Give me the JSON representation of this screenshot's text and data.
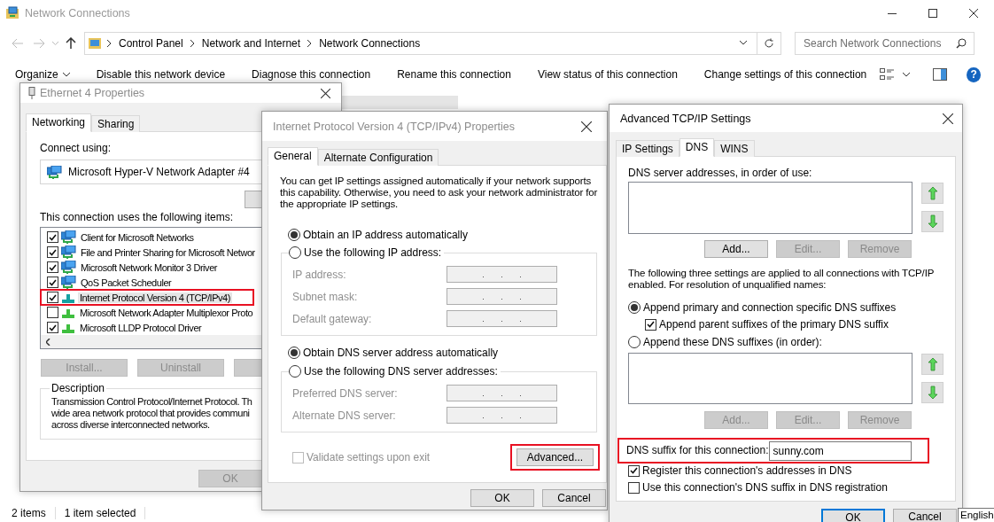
{
  "explorer": {
    "title": "Network Connections",
    "breadcrumb": [
      "Control Panel",
      "Network and Internet",
      "Network Connections"
    ],
    "search": {
      "placeholder": "Search Network Connections"
    },
    "toolbar": [
      {
        "label": "Organize",
        "kind": "menu"
      },
      {
        "label": "Disable this network device",
        "kind": "command"
      },
      {
        "label": "Diagnose this connection",
        "kind": "command"
      },
      {
        "label": "Rename this connection",
        "kind": "command"
      },
      {
        "label": "View status of this connection",
        "kind": "command"
      },
      {
        "label": "Change settings of this connection",
        "kind": "command"
      }
    ],
    "help": "?",
    "status_bar": [
      "2 items",
      "1 item selected"
    ]
  },
  "ethernet_dialog": {
    "title": "Ethernet 4 Properties",
    "tabs": [
      {
        "label": "Networking",
        "selected": true
      },
      {
        "label": "Sharing",
        "selected": false
      }
    ],
    "connect_label": "Connect using:",
    "adapter": "Microsoft Hyper-V Network Adapter #4",
    "items_label": "This connection uses the following items:",
    "items": [
      {
        "label": "Client for Microsoft Networks",
        "kind": "service",
        "checked": true,
        "selected": false,
        "highlighted": false
      },
      {
        "label": "File and Printer Sharing for Microsoft Networ",
        "kind": "service",
        "checked": true,
        "selected": false,
        "highlighted": false
      },
      {
        "label": "Microsoft Network Monitor 3 Driver",
        "kind": "service",
        "checked": true,
        "selected": false,
        "highlighted": false
      },
      {
        "label": "QoS Packet Scheduler",
        "kind": "service",
        "checked": true,
        "selected": false,
        "highlighted": false
      },
      {
        "label": "Internet Protocol Version 4 (TCP/IPv4)",
        "kind": "protocol",
        "checked": true,
        "selected": true,
        "highlighted": true
      },
      {
        "label": "Microsoft Network Adapter Multiplexor Proto",
        "kind": "protocol",
        "checked": false,
        "selected": false,
        "highlighted": false
      },
      {
        "label": "Microsoft LLDP Protocol Driver",
        "kind": "protocol",
        "checked": true,
        "selected": false,
        "highlighted": false
      }
    ],
    "buttons": [
      {
        "label": "Install...",
        "disabled": true
      },
      {
        "label": "Uninstall",
        "disabled": true
      }
    ],
    "description_title": "Description",
    "description_lines": [
      "Transmission Control Protocol/Internet Protocol. Th",
      "wide area network protocol that provides communi",
      "across diverse interconnected networks."
    ],
    "ok_button": {
      "label": "OK",
      "disabled": true
    }
  },
  "ipv4_dialog": {
    "title": "Internet Protocol Version 4 (TCP/IPv4) Properties",
    "tabs": [
      {
        "label": "General",
        "selected": true
      },
      {
        "label": "Alternate Configuration",
        "selected": false
      }
    ],
    "intro": "You can get IP settings assigned automatically if your network supports this capability. Otherwise, you need to ask your network administrator for the appropriate IP settings.",
    "ip_options": [
      {
        "label": "Obtain an IP address automatically",
        "selected": true
      },
      {
        "label": "Use the following IP address:",
        "selected": false
      }
    ],
    "ip_fields": [
      {
        "label": "IP address:",
        "disabled": true
      },
      {
        "label": "Subnet mask:",
        "disabled": true
      },
      {
        "label": "Default gateway:",
        "disabled": true
      }
    ],
    "dns_options": [
      {
        "label": "Obtain DNS server address automatically",
        "selected": true
      },
      {
        "label": "Use the following DNS server addresses:",
        "selected": false
      }
    ],
    "dns_fields": [
      {
        "label": "Preferred DNS server:",
        "disabled": true
      },
      {
        "label": "Alternate DNS server:",
        "disabled": true
      }
    ],
    "validate": {
      "label": "Validate settings upon exit",
      "checked": false,
      "disabled": true
    },
    "advanced_button": {
      "label": "Advanced...",
      "highlighted": true
    },
    "buttons": [
      {
        "label": "OK",
        "disabled": false
      },
      {
        "label": "Cancel",
        "disabled": false
      }
    ]
  },
  "advanced_dialog": {
    "title": "Advanced TCP/IP Settings",
    "tabs": [
      {
        "label": "IP Settings",
        "selected": false
      },
      {
        "label": "DNS",
        "selected": true
      },
      {
        "label": "WINS",
        "selected": false
      }
    ],
    "servers_label": "DNS server addresses, in order of use:",
    "server_buttons": [
      {
        "label": "Add...",
        "disabled": false
      },
      {
        "label": "Edit...",
        "disabled": true
      },
      {
        "label": "Remove",
        "disabled": true
      }
    ],
    "note": "The following three settings are applied to all connections with TCP/IP enabled. For resolution of unqualified names:",
    "append_primary": {
      "label": "Append primary and connection specific DNS suffixes",
      "selected": true
    },
    "append_parent": {
      "label": "Append parent suffixes of the primary DNS suffix",
      "checked": true
    },
    "append_these": {
      "label": "Append these DNS suffixes (in order):",
      "selected": false
    },
    "suffix_buttons": [
      {
        "label": "Add...",
        "disabled": true
      },
      {
        "label": "Edit...",
        "disabled": true
      },
      {
        "label": "Remove",
        "disabled": true
      }
    ],
    "suffix": {
      "label": "DNS suffix for this connection:",
      "value": "sunny.com",
      "highlighted": true
    },
    "register": {
      "label": "Register this connection's addresses in DNS",
      "checked": true
    },
    "use_suffix": {
      "label": "Use this connection's DNS suffix in DNS registration",
      "checked": false
    },
    "buttons": [
      {
        "label": "OK",
        "default": true
      },
      {
        "label": "Cancel",
        "default": false
      }
    ]
  },
  "language": "English"
}
